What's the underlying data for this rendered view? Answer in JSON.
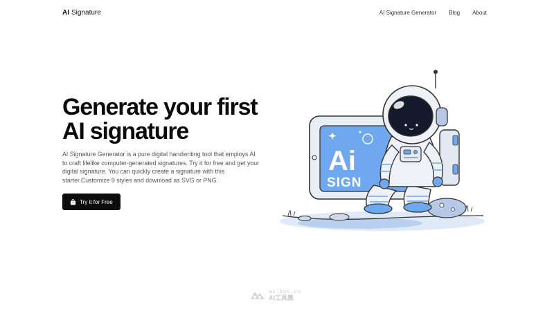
{
  "nav": {
    "logo_bold": "AI",
    "logo_rest": "Signature",
    "links": [
      "AI Signature Generator",
      "Blog",
      "About"
    ]
  },
  "hero": {
    "title_line1": "Generate your first",
    "title_line2": "AI signature",
    "description": "AI Signature Generator is a pure digital handwriting tool that employs AI to craft lifelike computer-generated signatures. Try it for free and get your digital signature. You can quickly create a signature with this starter.Customize 9 styles and download as SVG or PNG.",
    "cta_label": "Try it for Free",
    "cta_icon": "shopping-bag-icon"
  },
  "illustration": {
    "screen_text_line1": "Ai",
    "screen_text_line2": "SIGN",
    "icon": "astronaut-illustration"
  },
  "watermark": {
    "small": "ai-bot.cn",
    "big": "AI工具集"
  },
  "colors": {
    "accent_blue": "#6fa8ee",
    "cta_bg": "#0c0c0c",
    "text_dark": "#0b0b0b"
  }
}
